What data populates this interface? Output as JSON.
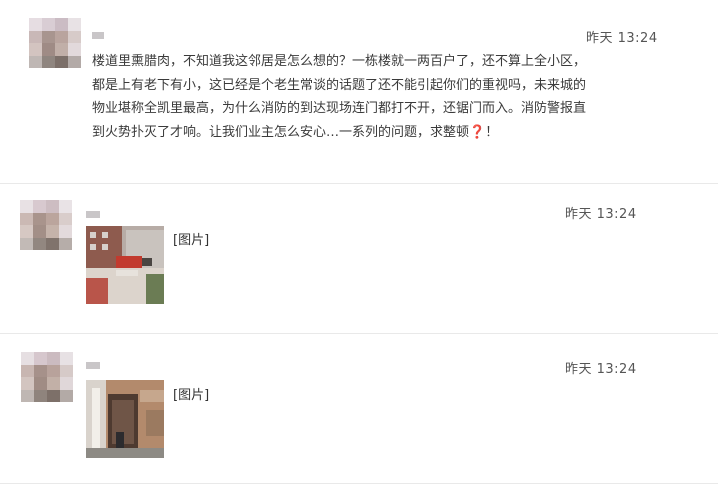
{
  "messages": [
    {
      "time": "昨天 13:24",
      "text": "楼道里熏腊肉，不知道我这邻居是怎么想的？一栋楼就一两百户了，还不算上全小区，都是上有老下有小，这已经是个老生常谈的话题了还不能引起你们的重视吗，未来城的物业堪称全凯里最高，为什么消防的到达现场连门都打不开，还锯门而入。消防警报直到火势扑灭了才响。让我们业主怎么安心…一系列的问题，求整顿",
      "emoji": "❓",
      "suffix": "！"
    },
    {
      "time": "昨天 13:24",
      "image_label": "[图片]"
    },
    {
      "time": "昨天 13:24",
      "image_label": "[图片]"
    }
  ]
}
